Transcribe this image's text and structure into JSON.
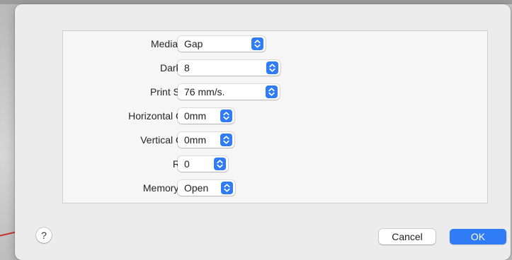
{
  "dialog": {
    "fields": [
      {
        "label": "Media Type:",
        "value": "Gap"
      },
      {
        "label": "Darkness:",
        "value": "8"
      },
      {
        "label": "Print Speed:",
        "value": "76 mm/s."
      },
      {
        "label": "Horizontal Offset:",
        "value": "0mm"
      },
      {
        "label": "Vertical Offset:",
        "value": "0mm"
      },
      {
        "label": "Rotate:",
        "value": "0"
      },
      {
        "label": "Memory Print:",
        "value": "Open"
      }
    ],
    "help_label": "?",
    "cancel_label": "Cancel",
    "ok_label": "OK"
  },
  "colors": {
    "accent": "#2f7cf6",
    "sheet_bg": "#ececec",
    "panel_bg": "#f6f6f6"
  },
  "icons": {
    "popup_indicator": "chevron-up-down-icon",
    "help": "question-mark-icon"
  }
}
